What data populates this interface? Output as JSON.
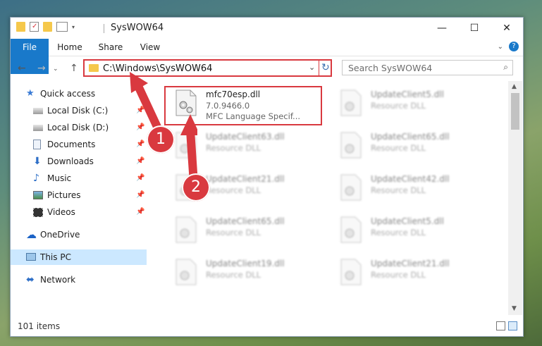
{
  "window": {
    "title": "SysWOW64"
  },
  "ribbon": {
    "tabs": [
      "File",
      "Home",
      "Share",
      "View"
    ]
  },
  "controls": {
    "minimize": "—",
    "maximize": "☐",
    "close": "✕"
  },
  "address": {
    "path": "C:\\Windows\\SysWOW64"
  },
  "search": {
    "placeholder": "Search SysWOW64"
  },
  "sidebar": {
    "items": [
      {
        "label": "Quick access",
        "icon": "star-icon"
      },
      {
        "label": "Local Disk (C:)",
        "icon": "drive-icon",
        "pinned": true
      },
      {
        "label": "Local Disk (D:)",
        "icon": "drive-icon",
        "pinned": true
      },
      {
        "label": "Documents",
        "icon": "documents-icon",
        "pinned": true
      },
      {
        "label": "Downloads",
        "icon": "download-icon",
        "pinned": true
      },
      {
        "label": "Music",
        "icon": "music-icon",
        "pinned": true
      },
      {
        "label": "Pictures",
        "icon": "pictures-icon",
        "pinned": true
      },
      {
        "label": "Videos",
        "icon": "videos-icon",
        "pinned": true
      },
      {
        "label": "OneDrive",
        "icon": "cloud-icon"
      },
      {
        "label": "This PC",
        "icon": "computer-icon",
        "selected": true
      },
      {
        "label": "Network",
        "icon": "network-icon"
      }
    ]
  },
  "files": [
    {
      "name": "mfc70esp.dll",
      "version": "7.0.9466.0",
      "desc": "MFC Language Specif..."
    },
    {
      "name": "UpdateClient5.dll",
      "desc": "Resource DLL"
    },
    {
      "name": "UpdateClient63.dll",
      "desc": "Resource DLL"
    },
    {
      "name": "UpdateClient65.dll",
      "desc": "Resource DLL"
    },
    {
      "name": "UpdateClient21.dll",
      "desc": "Resource DLL"
    },
    {
      "name": "UpdateClient42.dll",
      "desc": "Resource DLL"
    },
    {
      "name": "UpdateClient65.dll",
      "desc": "Resource DLL"
    },
    {
      "name": "UpdateClient5.dll",
      "desc": "Resource DLL"
    },
    {
      "name": "UpdateClient19.dll",
      "desc": "Resource DLL"
    },
    {
      "name": "UpdateClient21.dll",
      "desc": "Resource DLL"
    }
  ],
  "status": {
    "count": "101 items"
  },
  "annotations": {
    "step1": "1",
    "step2": "2"
  },
  "colors": {
    "accent": "#1979ca",
    "highlight": "#d9393f"
  }
}
